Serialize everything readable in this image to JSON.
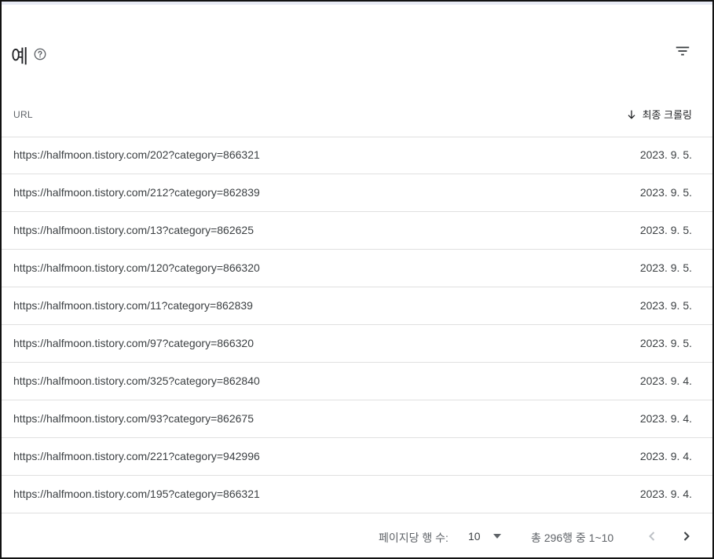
{
  "header": {
    "title": "예"
  },
  "icons": {
    "help": "help-circle-icon",
    "filter": "filter-icon",
    "sort": "arrow-down-icon",
    "prev": "chevron-left-icon",
    "next": "chevron-right-icon"
  },
  "table": {
    "columns": {
      "url": "URL",
      "last_crawl": "최종 크롤링"
    },
    "rows": [
      {
        "url": "https://halfmoon.tistory.com/202?category=866321",
        "date": "2023. 9. 5."
      },
      {
        "url": "https://halfmoon.tistory.com/212?category=862839",
        "date": "2023. 9. 5."
      },
      {
        "url": "https://halfmoon.tistory.com/13?category=862625",
        "date": "2023. 9. 5."
      },
      {
        "url": "https://halfmoon.tistory.com/120?category=866320",
        "date": "2023. 9. 5."
      },
      {
        "url": "https://halfmoon.tistory.com/11?category=862839",
        "date": "2023. 9. 5."
      },
      {
        "url": "https://halfmoon.tistory.com/97?category=866320",
        "date": "2023. 9. 5."
      },
      {
        "url": "https://halfmoon.tistory.com/325?category=862840",
        "date": "2023. 9. 4."
      },
      {
        "url": "https://halfmoon.tistory.com/93?category=862675",
        "date": "2023. 9. 4."
      },
      {
        "url": "https://halfmoon.tistory.com/221?category=942996",
        "date": "2023. 9. 4."
      },
      {
        "url": "https://halfmoon.tistory.com/195?category=866321",
        "date": "2023. 9. 4."
      }
    ]
  },
  "footer": {
    "rows_per_page_label": "페이지당 행 수:",
    "rows_per_page_value": "10",
    "range_text": "총 296행 중 1~10"
  }
}
